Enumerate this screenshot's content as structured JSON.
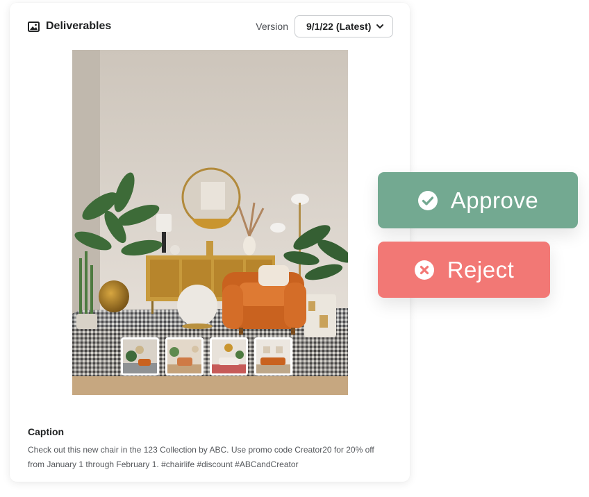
{
  "deliverables": {
    "title": "Deliverables",
    "title_icon": "image-icon",
    "version_label": "Version",
    "version_selected": "9/1/22 (Latest)",
    "thumbnails": [
      {
        "icon": "living-room-thumbnail-1"
      },
      {
        "icon": "living-room-thumbnail-2"
      },
      {
        "icon": "living-room-thumbnail-3"
      },
      {
        "icon": "living-room-thumbnail-4"
      }
    ]
  },
  "caption": {
    "title": "Caption",
    "text": "Check out this new chair in the 123 Collection by ABC. Use promo code Creator20 for 20% off from January 1 through February 1. #chairlife #discount #ABCandCreator"
  },
  "actions": {
    "approve": {
      "label": "Approve",
      "icon": "check-circle-icon",
      "color": "#73a991"
    },
    "reject": {
      "label": "Reject",
      "icon": "x-circle-icon",
      "color": "#f27875"
    }
  }
}
